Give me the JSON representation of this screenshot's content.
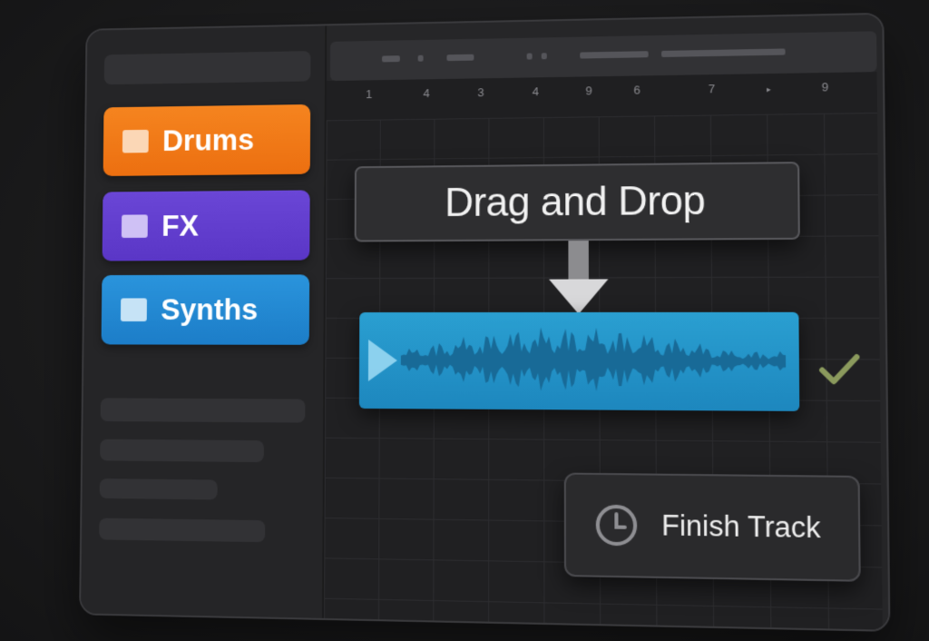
{
  "app": {
    "accent": "#2a94dc"
  },
  "sidebar": {
    "categories": [
      {
        "label": "Drums",
        "color": "#f5841f"
      },
      {
        "label": "FX",
        "color": "#6a46d6"
      },
      {
        "label": "Synths",
        "color": "#2a94dc"
      }
    ]
  },
  "timeline": {
    "ruler_ticks": [
      "1",
      "4",
      "3",
      "4",
      "9",
      "6",
      "7",
      "9"
    ]
  },
  "drag_hint": {
    "label": "Drag and Drop",
    "icon": "down-arrow-icon"
  },
  "clip": {
    "icon": "play-icon",
    "status_icon": "checkmark-icon",
    "color": "#2a9fd1"
  },
  "actions": {
    "finish_label": "Finish Track",
    "finish_icon": "clock-icon"
  }
}
